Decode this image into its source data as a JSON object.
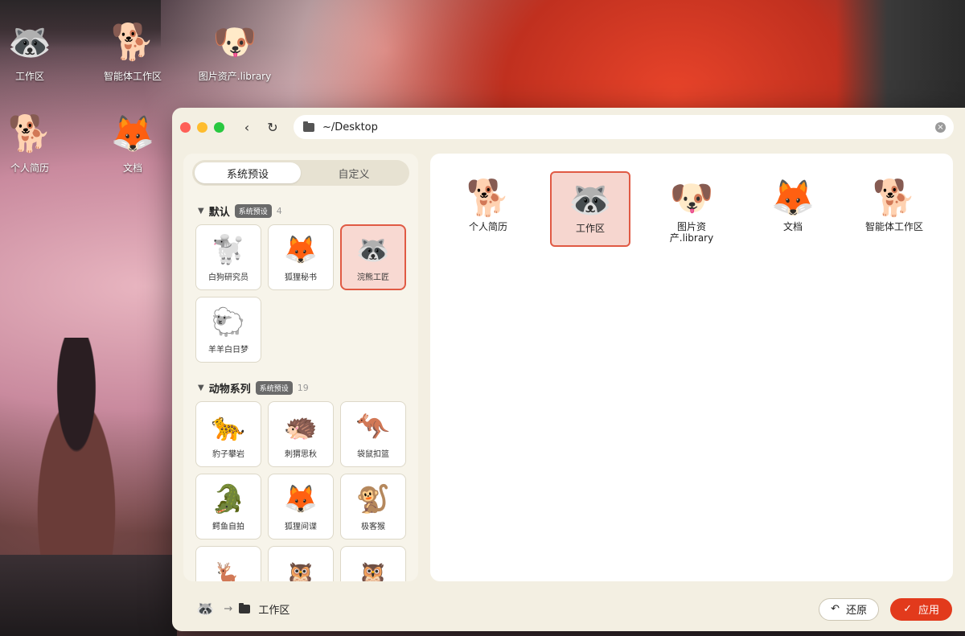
{
  "desktop": {
    "icons": [
      {
        "label": "工作区",
        "icon": "raccoon-workshop-icon",
        "glyph": "🦝"
      },
      {
        "label": "智能体工作区",
        "icon": "shiba-cheer-icon",
        "glyph": "🐕"
      },
      {
        "label": "图片资产.library",
        "icon": "shiba-face-icon",
        "glyph": "🐶"
      },
      {
        "label": "个人简历",
        "icon": "shiba-desk-icon",
        "glyph": "🐕"
      },
      {
        "label": "文档",
        "icon": "fox-books-icon",
        "glyph": "🦊"
      }
    ]
  },
  "window": {
    "path": "~/Desktop",
    "tabs": {
      "preset": "系统预设",
      "custom": "自定义"
    },
    "groups": [
      {
        "title": "默认",
        "badge": "系统预设",
        "count": "4",
        "items": [
          {
            "name": "白狗研究员",
            "glyph": "🐩"
          },
          {
            "name": "狐狸秘书",
            "glyph": "🦊"
          },
          {
            "name": "浣熊工匠",
            "glyph": "🦝"
          },
          {
            "name": "羊羊白日梦",
            "glyph": "🐑"
          }
        ]
      },
      {
        "title": "动物系列",
        "badge": "系统预设",
        "count": "19",
        "items": [
          {
            "name": "豹子攀岩",
            "glyph": "🐆"
          },
          {
            "name": "刺猬思秋",
            "glyph": "🦔"
          },
          {
            "name": "袋鼠扣篮",
            "glyph": "🦘"
          },
          {
            "name": "鳄鱼自拍",
            "glyph": "🐊"
          },
          {
            "name": "狐狸间谍",
            "glyph": "🦊"
          },
          {
            "name": "极客猴",
            "glyph": "🐒"
          },
          {
            "name": "",
            "glyph": "🦌"
          },
          {
            "name": "",
            "glyph": "🦉"
          },
          {
            "name": "",
            "glyph": "🦉"
          }
        ]
      }
    ],
    "files": [
      {
        "name": "个人简历",
        "glyph": "🐕"
      },
      {
        "name": "工作区",
        "glyph": "🦝"
      },
      {
        "name": "图片资\n产.library",
        "glyph": "🐶"
      },
      {
        "name": "文档",
        "glyph": "🦊"
      },
      {
        "name": "智能体工作区",
        "glyph": "🐕"
      }
    ],
    "footer": {
      "source_glyph": "🦝",
      "target": "工作区",
      "restore_label": "还原",
      "apply_label": "应用"
    }
  },
  "colors": {
    "accent": "#e23a1c",
    "selected_bg": "#f8d9d2"
  }
}
